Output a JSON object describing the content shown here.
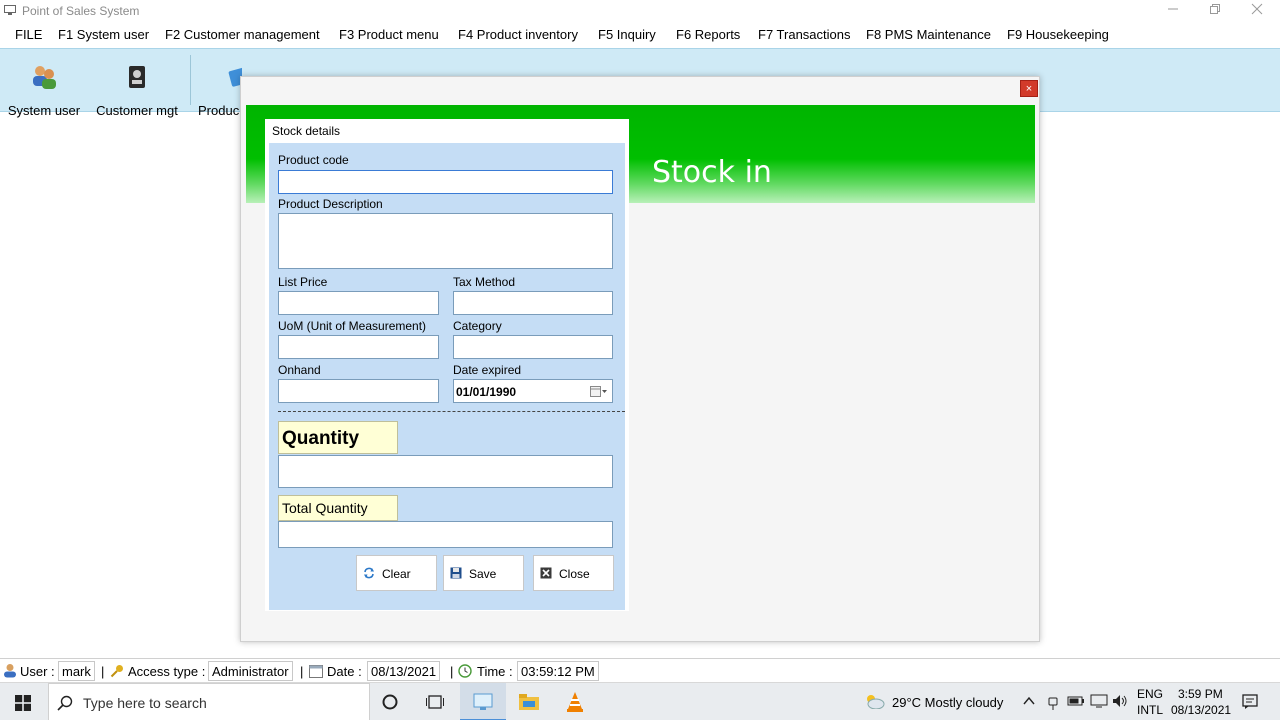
{
  "window": {
    "title": "Point of Sales System"
  },
  "menu": [
    "FILE",
    "F1 System user",
    "F2 Customer management",
    "F3 Product menu",
    "F4 Product inventory",
    "F5 Inquiry",
    "F6 Reports",
    "F7 Transactions",
    "F8 PMS Maintenance",
    "F9 Housekeeping"
  ],
  "toolbar": {
    "system_user": "System user",
    "customer_mgt": "Customer mgt",
    "product_partial": "Produc"
  },
  "dialog": {
    "close_glyph": "×",
    "banner_title": "Stock in",
    "panel_title": "Stock details",
    "labels": {
      "product_code": "Product code",
      "product_description": "Product Description",
      "list_price": "List Price",
      "tax_method": "Tax Method",
      "uom": "UoM (Unit of Measurement)",
      "category": "Category",
      "onhand": "Onhand",
      "date_expired": "Date expired",
      "quantity": "Quantity",
      "total_quantity": "Total Quantity"
    },
    "values": {
      "product_code": "",
      "product_description": "",
      "list_price": "",
      "tax_method": "",
      "uom": "",
      "category": "",
      "onhand": "",
      "date_expired": "01/01/1990",
      "quantity": "",
      "total_quantity": ""
    },
    "buttons": {
      "clear": "Clear",
      "save": "Save",
      "close": "Close"
    }
  },
  "status": {
    "user_label": "User :",
    "user_value": "mark",
    "access_label": "Access type :",
    "access_value": "Administrator",
    "date_label": "Date :",
    "date_value": "08/13/2021",
    "time_label": "Time :",
    "time_value": "03:59:12 PM"
  },
  "taskbar": {
    "search_placeholder": "Type here to search",
    "weather": "29°C  Mostly cloudy",
    "lang_top": "ENG",
    "lang_bottom": "INTL",
    "clock_time": "3:59 PM",
    "clock_date": "08/13/2021"
  },
  "colors": {
    "banner": "#00b400",
    "toolbar": "#cfeaf6",
    "panel": "#c5ddf5",
    "label_highlight": "#ffffd6",
    "close_red": "#d23a2a"
  }
}
